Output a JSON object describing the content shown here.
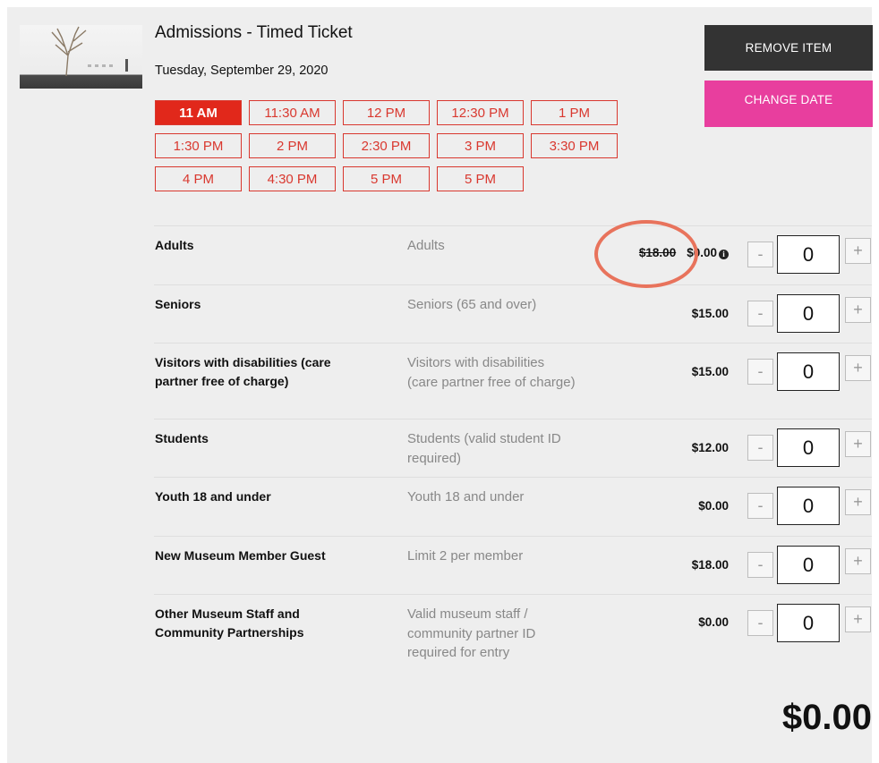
{
  "item": {
    "title": "Admissions - Timed Ticket",
    "date": "Tuesday, September 29, 2020"
  },
  "actions": {
    "remove_label": "REMOVE ITEM",
    "change_date_label": "CHANGE DATE"
  },
  "time_slots": [
    "11 AM",
    "11:30 AM",
    "12 PM",
    "12:30 PM",
    "1 PM",
    "1:30 PM",
    "2 PM",
    "2:30 PM",
    "3 PM",
    "3:30 PM",
    "4 PM",
    "4:30 PM",
    "5 PM",
    "5 PM"
  ],
  "selected_slot": "11 AM",
  "tickets": [
    {
      "name": "Adults",
      "description": "Adults",
      "original_price": "$18.00",
      "price": "$0.00",
      "qty": "0"
    },
    {
      "name": "Seniors",
      "description": "Seniors (65 and over)",
      "price": "$15.00",
      "qty": "0"
    },
    {
      "name": "Visitors with disabilities (care partner free of charge)",
      "description": "Visitors with disabilities (care partner free of charge)",
      "price": "$15.00",
      "qty": "0"
    },
    {
      "name": "Students",
      "description": "Students (valid student ID required)",
      "price": "$12.00",
      "qty": "0"
    },
    {
      "name": "Youth 18 and under",
      "description": "Youth 18 and under",
      "price": "$0.00",
      "qty": "0"
    },
    {
      "name": "New Museum Member Guest",
      "description": "Limit 2 per member",
      "price": "$18.00",
      "qty": "0"
    },
    {
      "name": "Other Museum Staff and Community Partnerships",
      "description": "Valid museum staff / community partner ID required for entry",
      "price": "$0.00",
      "qty": "0"
    }
  ],
  "stepper": {
    "minus": "-",
    "plus": "+"
  },
  "total": "$0.00",
  "colors": {
    "accent_red": "#e1281b",
    "change_pink": "#e83e9e",
    "remove_dark": "#333333",
    "annotation": "#e8735c"
  }
}
